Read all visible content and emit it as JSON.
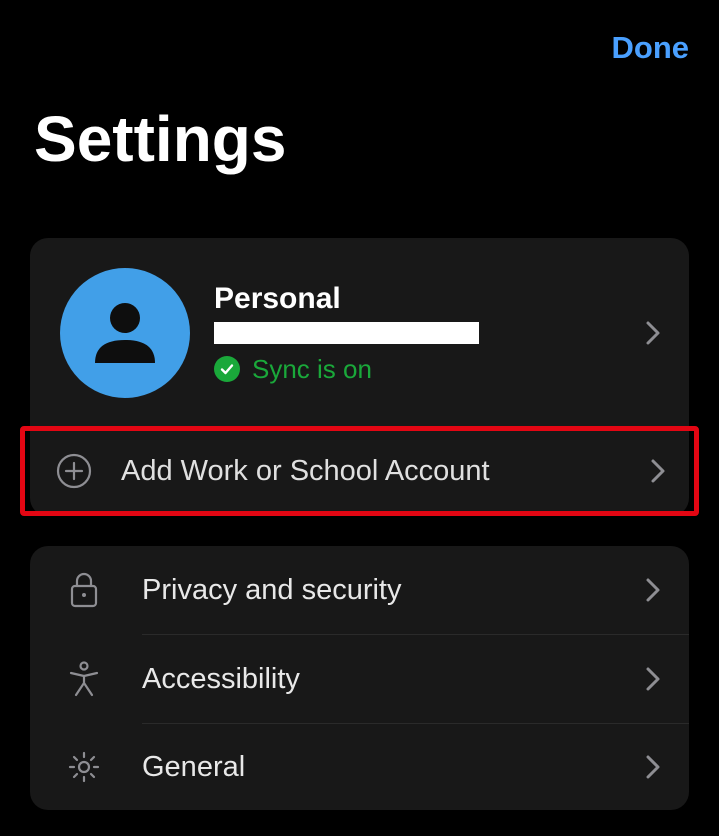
{
  "header": {
    "done_label": "Done"
  },
  "title": "Settings",
  "account": {
    "name": "Personal",
    "sync_label": "Sync is on"
  },
  "add_account_label": "Add Work or School Account",
  "menu": {
    "items": [
      {
        "label": "Privacy and security"
      },
      {
        "label": "Accessibility"
      },
      {
        "label": "General"
      }
    ]
  },
  "colors": {
    "accent_blue": "#4aa0ff",
    "avatar_blue": "#419fe8",
    "sync_green": "#1aa83a",
    "highlight_red": "#e30613"
  }
}
